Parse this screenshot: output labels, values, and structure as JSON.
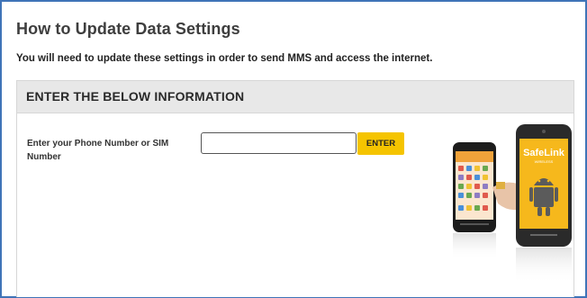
{
  "page": {
    "title": "How to Update Data Settings",
    "intro": "You will need to update these settings in order to send MMS and access the internet."
  },
  "panel": {
    "title": "ENTER THE BELOW INFORMATION",
    "field_label": "Enter your Phone Number or SIM Number",
    "phone_input": {
      "value": "",
      "placeholder": ""
    },
    "enter_button_label": "ENTER"
  },
  "illustration": {
    "brand_text": "SafeLink",
    "sub_text": "WIRELESS",
    "colors": {
      "screen_yellow": "#f6b81c",
      "android_green": "#5b5b5b"
    }
  }
}
